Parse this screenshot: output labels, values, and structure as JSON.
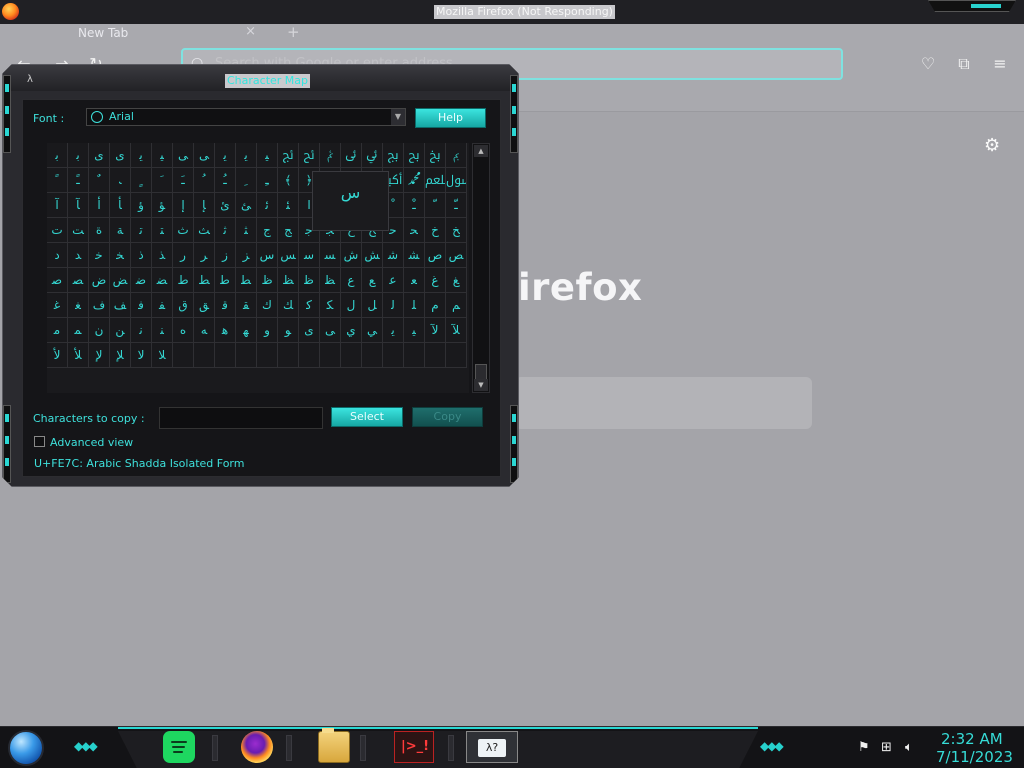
{
  "firefox": {
    "window_title": "Mozilla Firefox (Not Responding)",
    "tab_label": "New Tab",
    "tab_close": "×",
    "new_tab": "+",
    "url_placeholder": "Search with Google or enter address",
    "brand_text": "irefox"
  },
  "charmap": {
    "title": "Character Map",
    "font_label": "Font :",
    "font_value": "Arial",
    "help_label": "Help",
    "copy_label": "Characters to copy :",
    "copy_value": "",
    "select_label": "Select",
    "copy_button": "Copy",
    "advanced_label": "Advanced view",
    "advanced_checked": false,
    "status": "U+FE7C: Arabic Shadda Isolated Form",
    "zoom_char": "ﺱ",
    "selected_index": 242,
    "grid": [
      "ﺑ",
      "ﺑ",
      "ﯼ",
      "ﯼ",
      "ﯾ",
      "ﯿ",
      "ﯽ",
      "ﯽ",
      "ﯾ",
      "ﯾ",
      "ﯿ",
      "ﰀ",
      "ﰁ",
      "ﰂ",
      "ﰃ",
      "ﰄ",
      "ﰅ",
      "ﰆ",
      "ﰇ",
      "ﰈ",
      "ﹰ",
      "ﹱ",
      "ﹲ",
      "ﹳ",
      "ﹴ",
      "ﹶ",
      "ﹷ",
      "ﹸ",
      "ﹹ",
      "ﹺ",
      "ﹻ",
      "﴾",
      "﴿",
      "ﷰ",
      "ﷱ",
      "ﷲ",
      "ﷳ",
      "ﷴ",
      "ﷵ",
      "ﷶ",
      "ﺁ",
      "ﺂ",
      "ﺃ",
      "ﺄ",
      "ﺅ",
      "ﺆ",
      "ﺇ",
      "ﺈ",
      "ﺉ",
      "ﺊ",
      "ﺋ",
      "ﺌ",
      "ﺍ",
      "ﺎ",
      "ﺏ",
      "ﺐ",
      "ﹾ",
      "ﹿ",
      "ﹼ",
      "ﹽ",
      "ﺕ",
      "ﺖ",
      "ﺓ",
      "ﺔ",
      "ﺗ",
      "ﺘ",
      "ﺙ",
      "ﺚ",
      "ﺛ",
      "ﺜ",
      "ﺝ",
      "ﺞ",
      "ﺟ",
      "ﺠ",
      "ﺡ",
      "ﺢ",
      "ﺣ",
      "ﺤ",
      "ﺥ",
      "ﺦ",
      "ﺩ",
      "ﺪ",
      "ﺧ",
      "ﺨ",
      "ﺫ",
      "ﺬ",
      "ﺭ",
      "ﺮ",
      "ﺯ",
      "ﺰ",
      "ﺱ",
      "ﺲ",
      "ﺳ",
      "ﺴ",
      "ﺵ",
      "ﺶ",
      "ﺷ",
      "ﺸ",
      "ﺹ",
      "ﺺ",
      "ﺻ",
      "ﺼ",
      "ﺽ",
      "ﺾ",
      "ﺿ",
      "ﻀ",
      "ﻁ",
      "ﻂ",
      "ﻃ",
      "ﻄ",
      "ﻅ",
      "ﻆ",
      "ﻇ",
      "ﻈ",
      "ﻉ",
      "ﻊ",
      "ﻋ",
      "ﻌ",
      "ﻍ",
      "ﻎ",
      "ﻏ",
      "ﻐ",
      "ﻑ",
      "ﻒ",
      "ﻓ",
      "ﻔ",
      "ﻕ",
      "ﻖ",
      "ﻗ",
      "ﻘ",
      "ﻙ",
      "ﻚ",
      "ﻛ",
      "ﻜ",
      "ﻝ",
      "ﻞ",
      "ﻟ",
      "ﻠ",
      "ﻡ",
      "ﻢ",
      "ﻣ",
      "ﻤ",
      "ﻥ",
      "ﻦ",
      "ﻧ",
      "ﻨ",
      "ﻩ",
      "ﻪ",
      "ﻫ",
      "ﻬ",
      "ﻭ",
      "ﻮ",
      "ﻯ",
      "ﻰ",
      "ﻱ",
      "ﻲ",
      "ﻳ",
      "ﻴ",
      "ﻵ",
      "ﻶ",
      "ﻷ",
      "ﻸ",
      "ﻹ",
      "ﻺ",
      "ﻻ",
      "ﻼ",
      "﻿",
      "",
      "",
      "",
      "",
      "",
      "",
      "",
      "",
      "",
      "",
      "",
      "",
      ""
    ]
  },
  "taskbar": {
    "time": "2:32 AM",
    "date": "7/11/2023",
    "term_text": "|>_!",
    "charmap_icon_text": "λ?"
  }
}
